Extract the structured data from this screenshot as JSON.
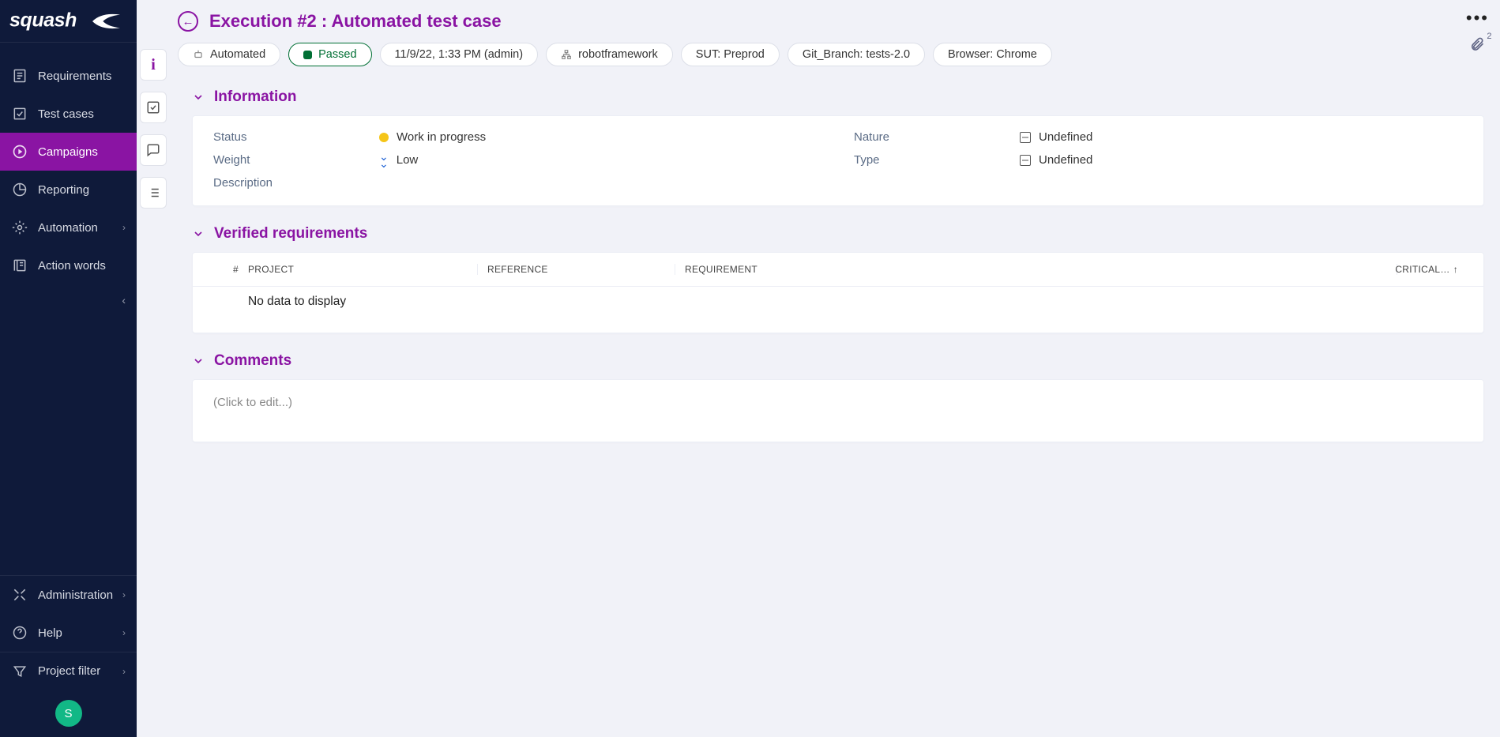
{
  "sidebar": {
    "items": [
      {
        "label": "Requirements"
      },
      {
        "label": "Test cases"
      },
      {
        "label": "Campaigns"
      },
      {
        "label": "Reporting"
      },
      {
        "label": "Automation"
      },
      {
        "label": "Action words"
      }
    ],
    "bottom": [
      {
        "label": "Administration"
      },
      {
        "label": "Help"
      },
      {
        "label": "Project filter"
      }
    ],
    "avatar": "S"
  },
  "header": {
    "title": "Execution #2 : Automated test case",
    "attachments": "2"
  },
  "pills": {
    "mode": "Automated",
    "status": "Passed",
    "when": "11/9/22, 1:33 PM (admin)",
    "tech": "robotframework",
    "sut": "SUT: Preprod",
    "branch": "Git_Branch: tests-2.0",
    "browser": "Browser: Chrome"
  },
  "sections": {
    "information": "Information",
    "verified": "Verified requirements",
    "comments": "Comments"
  },
  "info": {
    "status_label": "Status",
    "status_value": "Work in progress",
    "nature_label": "Nature",
    "nature_value": "Undefined",
    "weight_label": "Weight",
    "weight_value": "Low",
    "type_label": "Type",
    "type_value": "Undefined",
    "description_label": "Description"
  },
  "table": {
    "hash": "#",
    "project": "PROJECT",
    "reference": "REFERENCE",
    "requirement": "REQUIREMENT",
    "criticality": "CRITICAL…",
    "empty": "No data to display"
  },
  "comments": {
    "placeholder": "(Click to edit...)"
  }
}
